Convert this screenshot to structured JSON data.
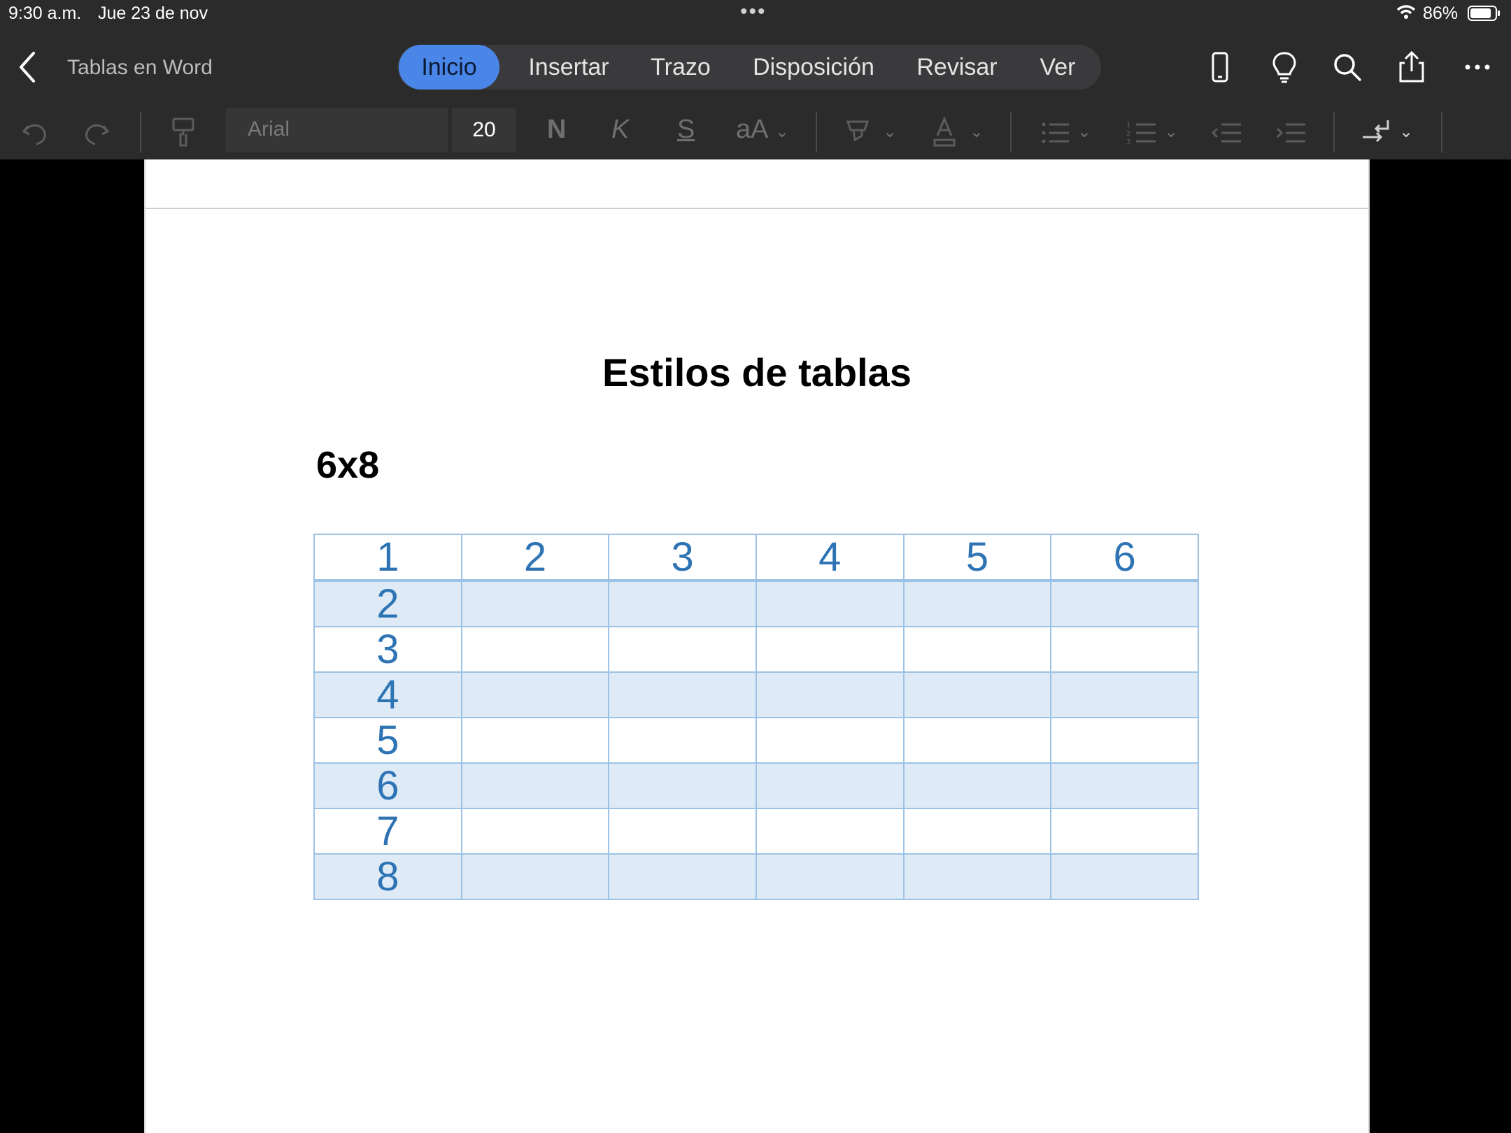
{
  "status": {
    "time": "9:30 a.m.",
    "date": "Jue 23 de nov",
    "battery": "86%",
    "battery_level": 0.86
  },
  "toolbar": {
    "doc_title": "Tablas en Word",
    "tabs": [
      {
        "label": "Inicio",
        "active": true
      },
      {
        "label": "Insertar",
        "active": false
      },
      {
        "label": "Trazo",
        "active": false
      },
      {
        "label": "Disposición",
        "active": false
      },
      {
        "label": "Revisar",
        "active": false
      },
      {
        "label": "Ver",
        "active": false
      }
    ],
    "icons": [
      "back-chevron-icon",
      "phone-view-icon",
      "lightbulb-icon",
      "search-icon",
      "share-icon",
      "more-icon"
    ]
  },
  "ribbon": {
    "font_name": "Arial",
    "font_size": "20",
    "bold": "N",
    "italic": "K",
    "underline": "S",
    "case": "aA",
    "icons": [
      "undo-icon",
      "redo-icon",
      "format-painter-icon",
      "highlighter-icon",
      "font-color-icon",
      "bullet-list-icon",
      "numbered-list-icon",
      "decrease-indent-icon",
      "increase-indent-icon",
      "paragraph-mark-icon"
    ]
  },
  "document": {
    "heading": "Estilos de tablas",
    "subheading": "6x8",
    "table": {
      "header": [
        "1",
        "2",
        "3",
        "4",
        "5",
        "6"
      ],
      "rows": [
        [
          "2",
          "",
          "",
          "",
          "",
          ""
        ],
        [
          "3",
          "",
          "",
          "",
          "",
          ""
        ],
        [
          "4",
          "",
          "",
          "",
          "",
          ""
        ],
        [
          "5",
          "",
          "",
          "",
          "",
          ""
        ],
        [
          "6",
          "",
          "",
          "",
          "",
          ""
        ],
        [
          "7",
          "",
          "",
          "",
          "",
          ""
        ],
        [
          "8",
          "",
          "",
          "",
          "",
          ""
        ]
      ]
    }
  },
  "colors": {
    "accent": "#4a86e8",
    "table_text": "#2e74b5",
    "table_border": "#9cc2e5",
    "table_band": "#deeaf6"
  }
}
